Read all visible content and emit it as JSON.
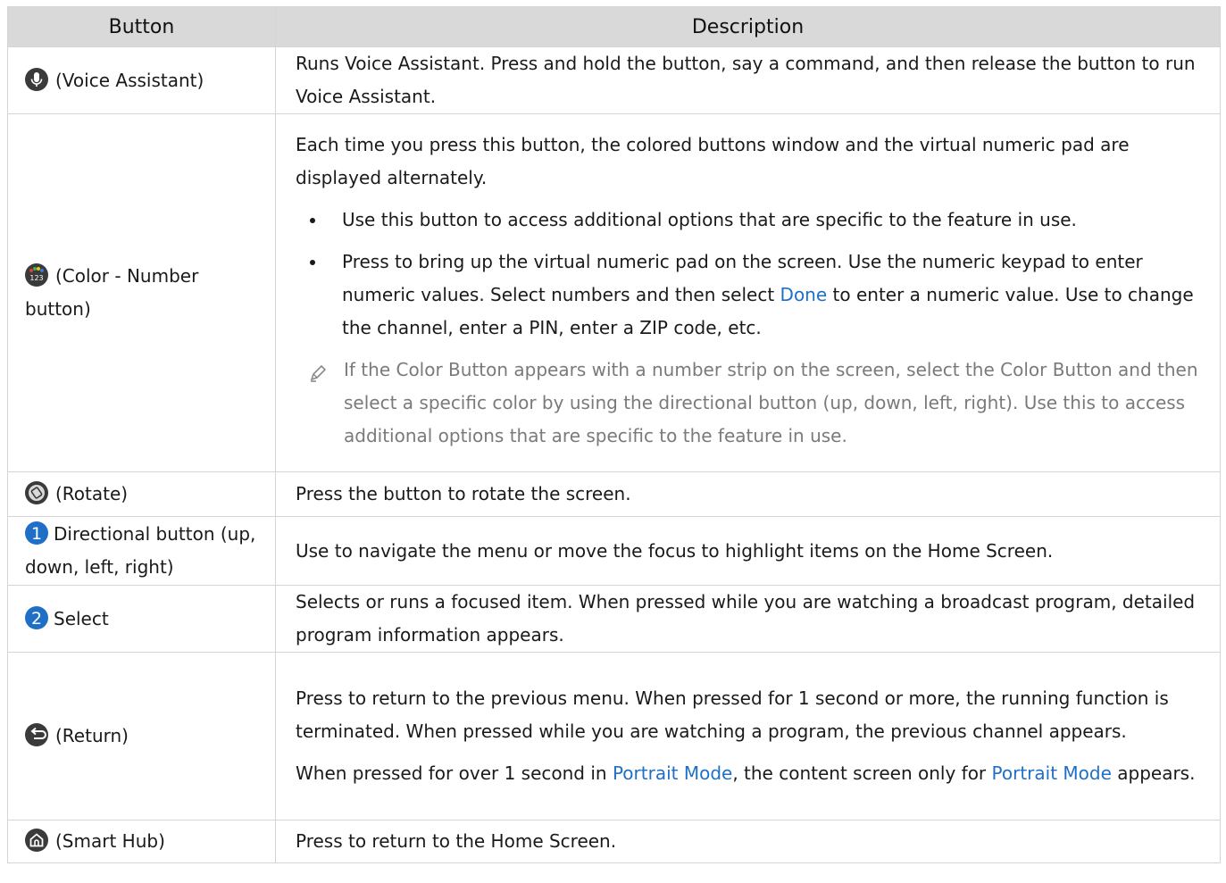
{
  "table": {
    "headers": {
      "button": "Button",
      "description": "Description"
    },
    "rows": {
      "voice": {
        "label": "(Voice Assistant)",
        "icon": "microphone-icon",
        "desc": "Runs Voice Assistant. Press and hold the button, say a command, and then release the button to run Voice Assistant."
      },
      "color": {
        "label": "(Color - Number button)",
        "icon": "color-number-icon",
        "desc": "Each time you press this button, the colored buttons window and the virtual numeric pad are displayed alternately.",
        "bullet1": "Use this button to access additional options that are specific to the feature in use.",
        "bullet2_pre": "Press to bring up the virtual numeric pad on the screen. Use the numeric keypad to enter numeric values. Select numbers and then select ",
        "bullet2_link": "Done",
        "bullet2_post": " to enter a numeric value. Use to change the channel, enter a PIN, enter a ZIP code, etc.",
        "note": "If the Color Button appears with a number strip on the screen, select the Color Button and then select a specific color by using the directional button (up, down, left, right). Use this to access additional options that are specific to the feature in use.",
        "note_icon": "pencil-icon"
      },
      "rotate": {
        "label": "(Rotate)",
        "icon": "rotate-icon",
        "desc": "Press the button to rotate the screen."
      },
      "directional": {
        "num": "1",
        "label": "Directional button (up, down, left, right)",
        "desc": "Use to navigate the menu or move the focus to highlight items on the Home Screen."
      },
      "select": {
        "num": "2",
        "label": "Select",
        "desc": "Selects or runs a focused item. When pressed while you are watching a broadcast program, detailed program information appears."
      },
      "return": {
        "label": "(Return)",
        "icon": "return-icon",
        "desc1": "Press to return to the previous menu. When pressed for 1 second or more, the running function is terminated. When pressed while you are watching a program, the previous channel appears.",
        "desc2_pre": "When pressed for over 1 second in ",
        "desc2_link1": "Portrait Mode",
        "desc2_mid": ", the content screen only for ",
        "desc2_link2": "Portrait Mode",
        "desc2_post": " appears."
      },
      "smarthub": {
        "label": "(Smart Hub)",
        "icon": "home-icon",
        "desc": "Press to return to the Home Screen."
      }
    }
  },
  "colors": {
    "link": "#1f6fc7",
    "number_badge": "#1f6fc7",
    "header_bg": "#d9d9d9",
    "note_text": "#7a7a7a"
  }
}
